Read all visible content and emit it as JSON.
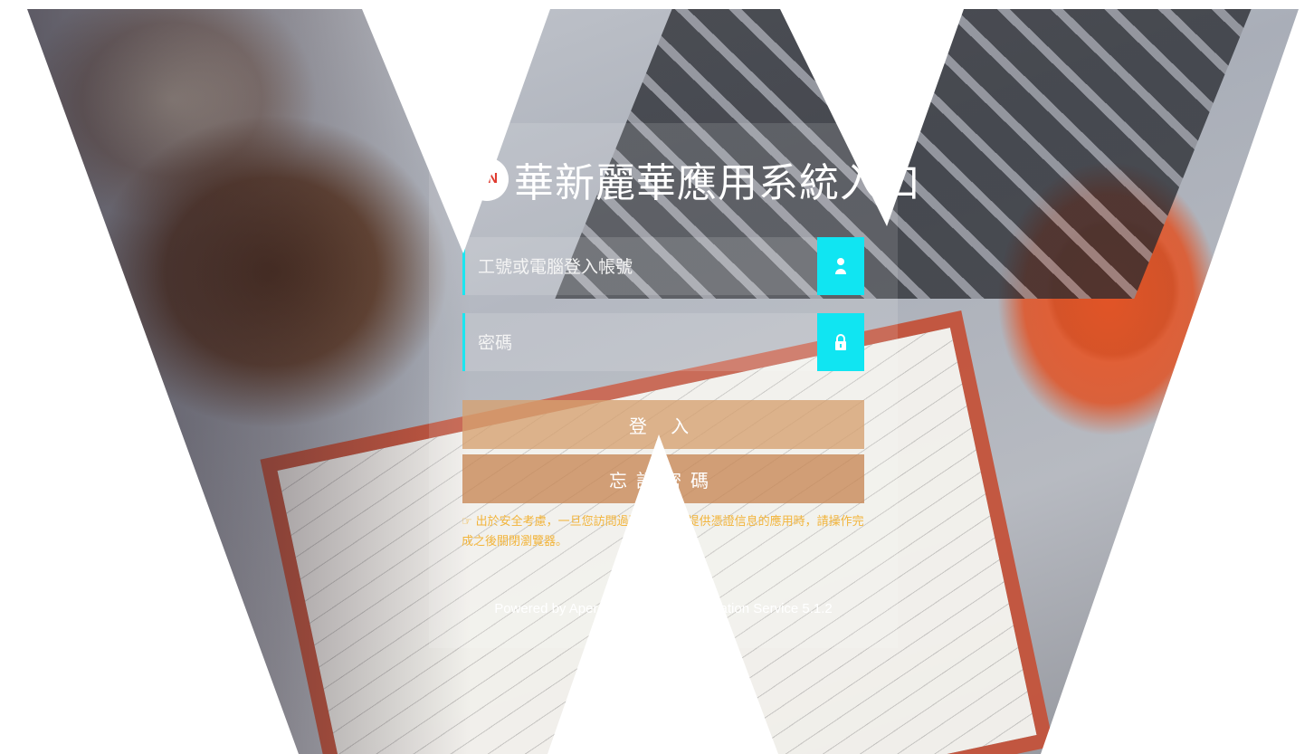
{
  "brand": {
    "logo_text": "GN",
    "title": "華新麗華應用系統入口"
  },
  "login": {
    "username_placeholder": "工號或電腦登入帳號",
    "password_placeholder": "密碼",
    "username_icon": "user-icon",
    "password_icon": "lock-icon",
    "login_label": "登 入",
    "forgot_label": "忘記密碼"
  },
  "notice": {
    "icon": "hand-pointer-icon",
    "text": "出於安全考慮，一旦您訪問過那些需要您提供憑證信息的應用時，請操作完成之後關閉瀏覽器。"
  },
  "footer": {
    "text": "Powered by Apereo Central Authentication Service 5.1.2"
  },
  "colors": {
    "accent": "#10e5f2",
    "login_button": "#d6a070",
    "forgot_button": "#c88755",
    "notice_text": "#f2b43a"
  }
}
